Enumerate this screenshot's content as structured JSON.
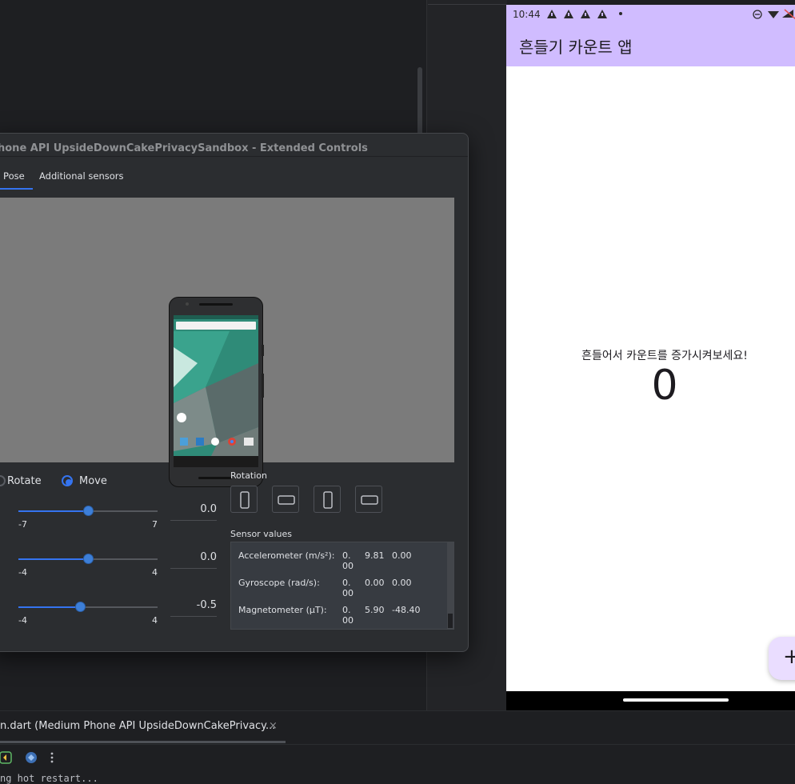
{
  "extended_controls": {
    "title": "hone API UpsideDownCakePrivacySandbox - Extended Controls",
    "tabs": [
      {
        "label": "ce Pose",
        "active": true
      },
      {
        "label": "Additional sensors",
        "active": false
      }
    ],
    "mode": {
      "rotate_label": "Rotate",
      "move_label": "Move",
      "selected": "Move"
    },
    "sliders": [
      {
        "min_label": "-7",
        "max_label": "7",
        "value": "0.0"
      },
      {
        "min_label": "-4",
        "max_label": "4",
        "value": "0.0"
      },
      {
        "min_label": "-4",
        "max_label": "4",
        "value": "-0.5"
      }
    ],
    "rotation_label": "Rotation",
    "sensor_values_label": "Sensor values",
    "sensors": [
      {
        "name": "Accelerometer (m/s²):",
        "v1a": "0.",
        "v1b": "00",
        "v2": "9.81",
        "v3": "0.00"
      },
      {
        "name": "Gyroscope (rad/s):",
        "v1a": "0.",
        "v1b": "00",
        "v2": "0.00",
        "v3": "0.00"
      },
      {
        "name": "Magnetometer (μT):",
        "v1a": "0.",
        "v1b": "00",
        "v2": "5.90",
        "v3": "-48.40"
      }
    ]
  },
  "device": {
    "status_time": "10:44",
    "app_title": "흔들기 카운트 앱",
    "message": "흔들어서 카운트를 증가시켜보세요!",
    "counter": "0",
    "fab_icon": "+",
    "appbar_color": "#d0bcff",
    "fab_color": "#eaddff"
  },
  "ide": {
    "run_tab_label": "n.dart (Medium Phone API UpsideDownCakePrivacy...",
    "run_tab_close": "×",
    "console_line": "ng hot restart..."
  }
}
